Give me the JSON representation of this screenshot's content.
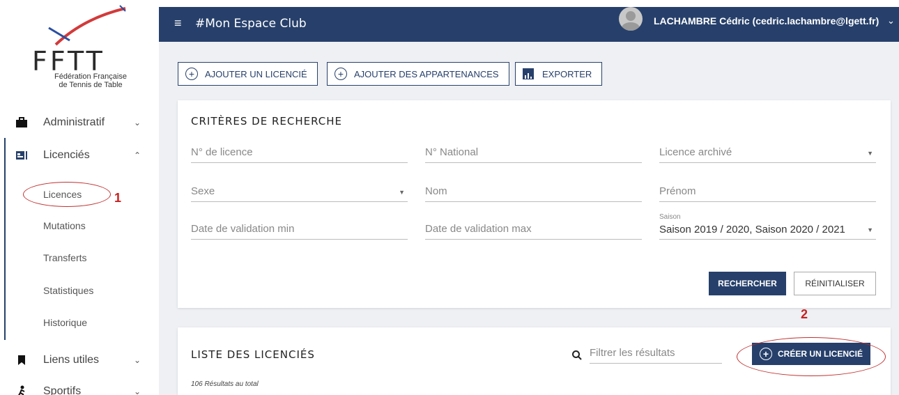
{
  "logo": {
    "acronym": "FFTT",
    "line1": "Fédération Française",
    "line2": "de Tennis de Table"
  },
  "sidebar": {
    "items": [
      {
        "label": "Administratif",
        "icon": "briefcase-icon",
        "chevron": "chevron-down-icon"
      },
      {
        "label": "Licenciés",
        "icon": "id-card-icon",
        "chevron": "chevron-up-icon"
      },
      {
        "label": "Liens utiles",
        "icon": "bookmark-icon",
        "chevron": "chevron-down-icon"
      },
      {
        "label": "Sportifs",
        "icon": "runner-icon",
        "chevron": "chevron-down-icon"
      }
    ],
    "sub_items": [
      "Licences",
      "Mutations",
      "Transferts",
      "Statistiques",
      "Historique"
    ]
  },
  "annotations": {
    "one": "1",
    "two": "2"
  },
  "header": {
    "title": "#Mon Espace Club",
    "user": "LACHAMBRE Cédric (cedric.lachambre@lgett.fr)"
  },
  "toolbar": {
    "add_licencie": "AJOUTER UN LICENCIÉ",
    "add_appartenances": "AJOUTER DES APPARTENANCES",
    "export": "EXPORTER"
  },
  "criteria": {
    "title": "CRITÈRES DE RECHERCHE",
    "fields": {
      "licence_no": "N° de licence",
      "national_no": "N° National",
      "licence_archived": "Licence archivé",
      "sexe": "Sexe",
      "nom": "Nom",
      "prenom": "Prénom",
      "date_min": "Date de validation min",
      "date_max": "Date de validation max",
      "saison_label": "Saison",
      "saison_value": "Saison 2019 / 2020, Saison 2020 / 2021"
    },
    "search_button": "RECHERCHER",
    "reset_button": "RÉINITIALISER"
  },
  "list": {
    "title": "LISTE DES LICENCIÉS",
    "filter_placeholder": "Filtrer les résultats",
    "create_button": "CRÉER UN LICENCIÉ",
    "results": "106 Résultats au total"
  },
  "colors": {
    "primary": "#27406b",
    "annotation": "#c82020"
  }
}
